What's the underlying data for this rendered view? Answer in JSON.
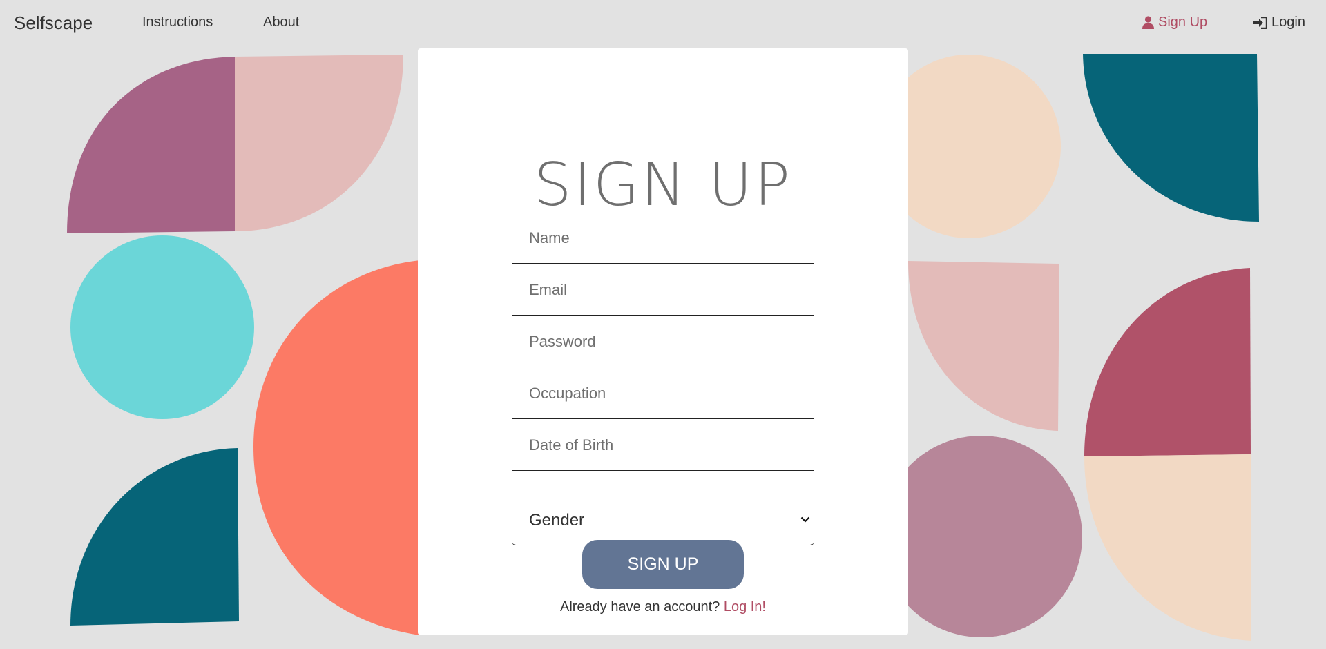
{
  "nav": {
    "brand": "Selfscape",
    "links": [
      {
        "label": "Instructions"
      },
      {
        "label": "About"
      }
    ],
    "signup_label": "Sign Up",
    "signup_icon": "user-icon",
    "login_label": "Login",
    "login_icon": "sign-in-icon"
  },
  "form": {
    "title": "SIGN UP",
    "fields": [
      {
        "placeholder": "Name",
        "value": ""
      },
      {
        "placeholder": "Email",
        "value": ""
      },
      {
        "placeholder": "Password",
        "value": ""
      },
      {
        "placeholder": "Occupation",
        "value": ""
      },
      {
        "placeholder": "Date of Birth",
        "value": ""
      }
    ],
    "gender_select": {
      "selected": "Gender"
    },
    "submit_label": "SIGN UP",
    "footer_text": "Already have an account?",
    "footer_link": "Log In!"
  },
  "colors": {
    "accent": "#b04d64",
    "button": "#627594",
    "background": "#e2e2e2",
    "purple": "#a66386",
    "pink": "#e3bbb9",
    "cyan": "#6bd6d8",
    "teal": "#066478",
    "coral": "#fc7a65",
    "peach": "#f2d9c4",
    "mauve": "#b78699",
    "raspberry": "#b05269"
  }
}
